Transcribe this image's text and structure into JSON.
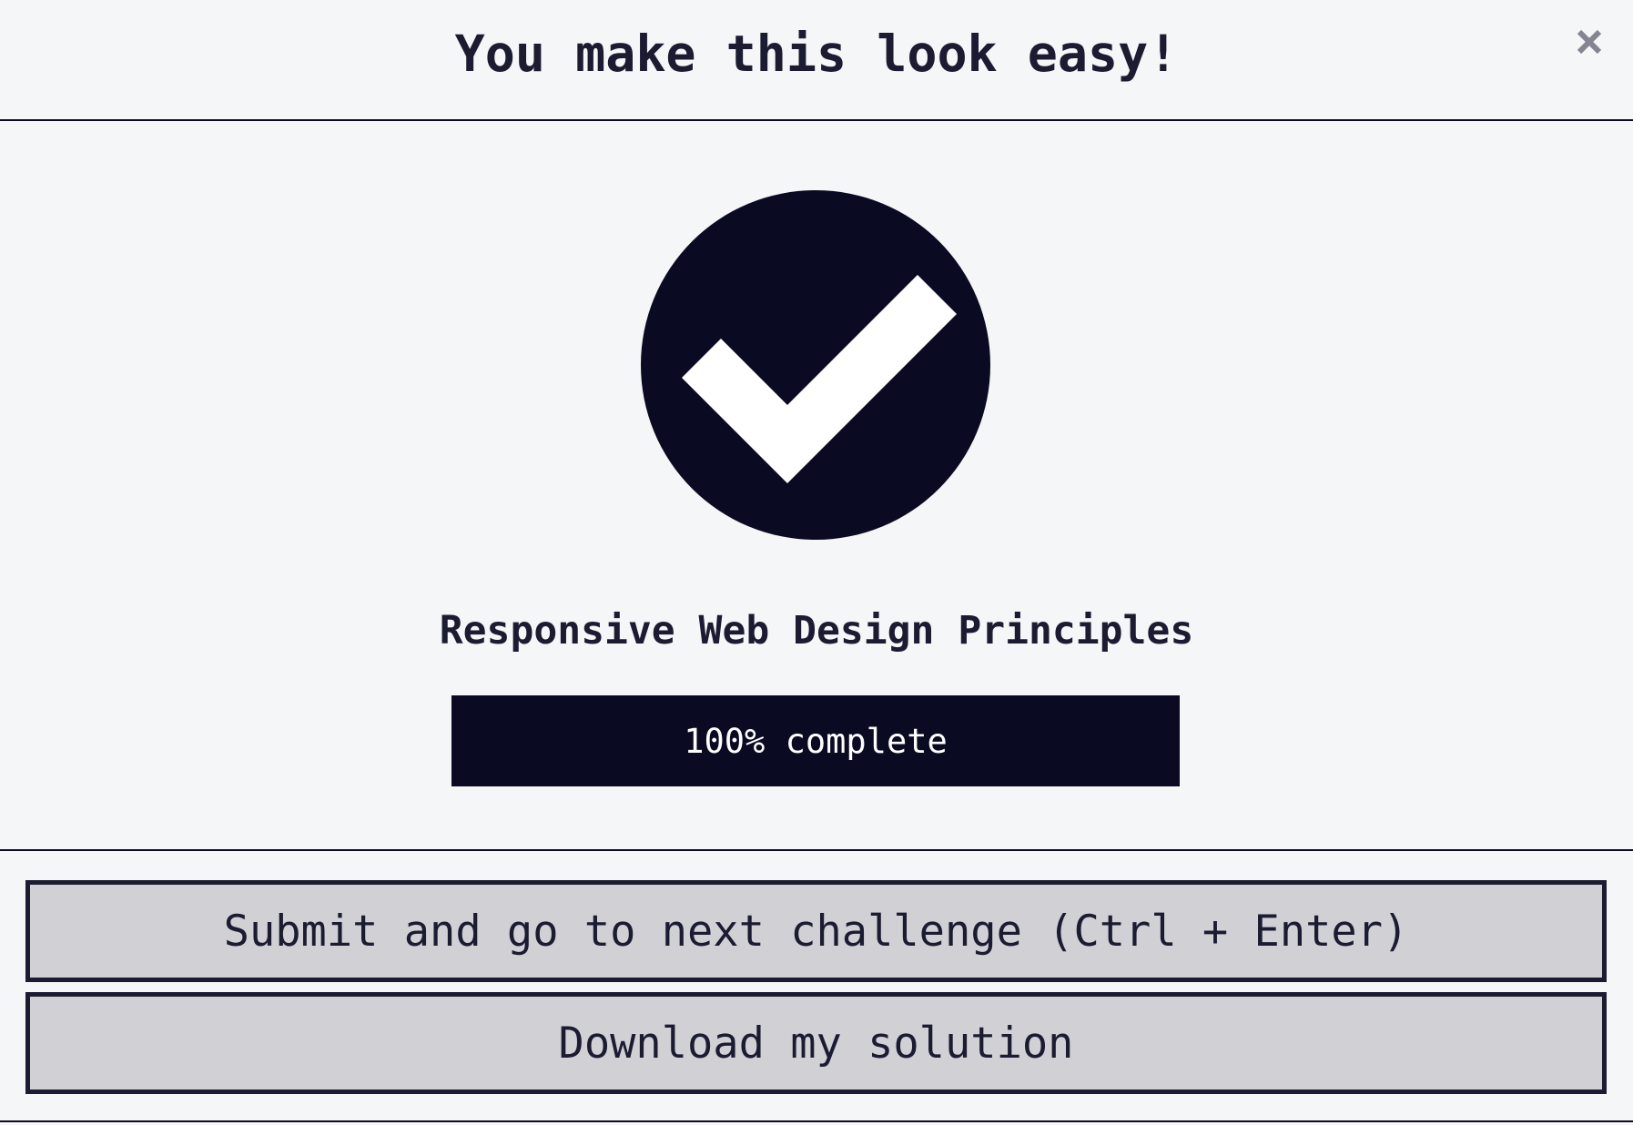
{
  "modal": {
    "title": "You make this look easy!",
    "close_label": "×"
  },
  "challenge": {
    "title": "Responsive Web Design Principles"
  },
  "progress": {
    "percent": 100,
    "label": "100% complete"
  },
  "buttons": {
    "submit_label": "Submit and go to next challenge (Ctrl + Enter)",
    "download_label": "Download my solution"
  },
  "icons": {
    "close": "close-icon",
    "success": "check-circle-icon"
  },
  "colors": {
    "primary": "#0a0a23",
    "text": "#1b1b32",
    "background": "#f5f6f7",
    "button_bg": "#d0d0d5",
    "close_icon": "#858591"
  }
}
